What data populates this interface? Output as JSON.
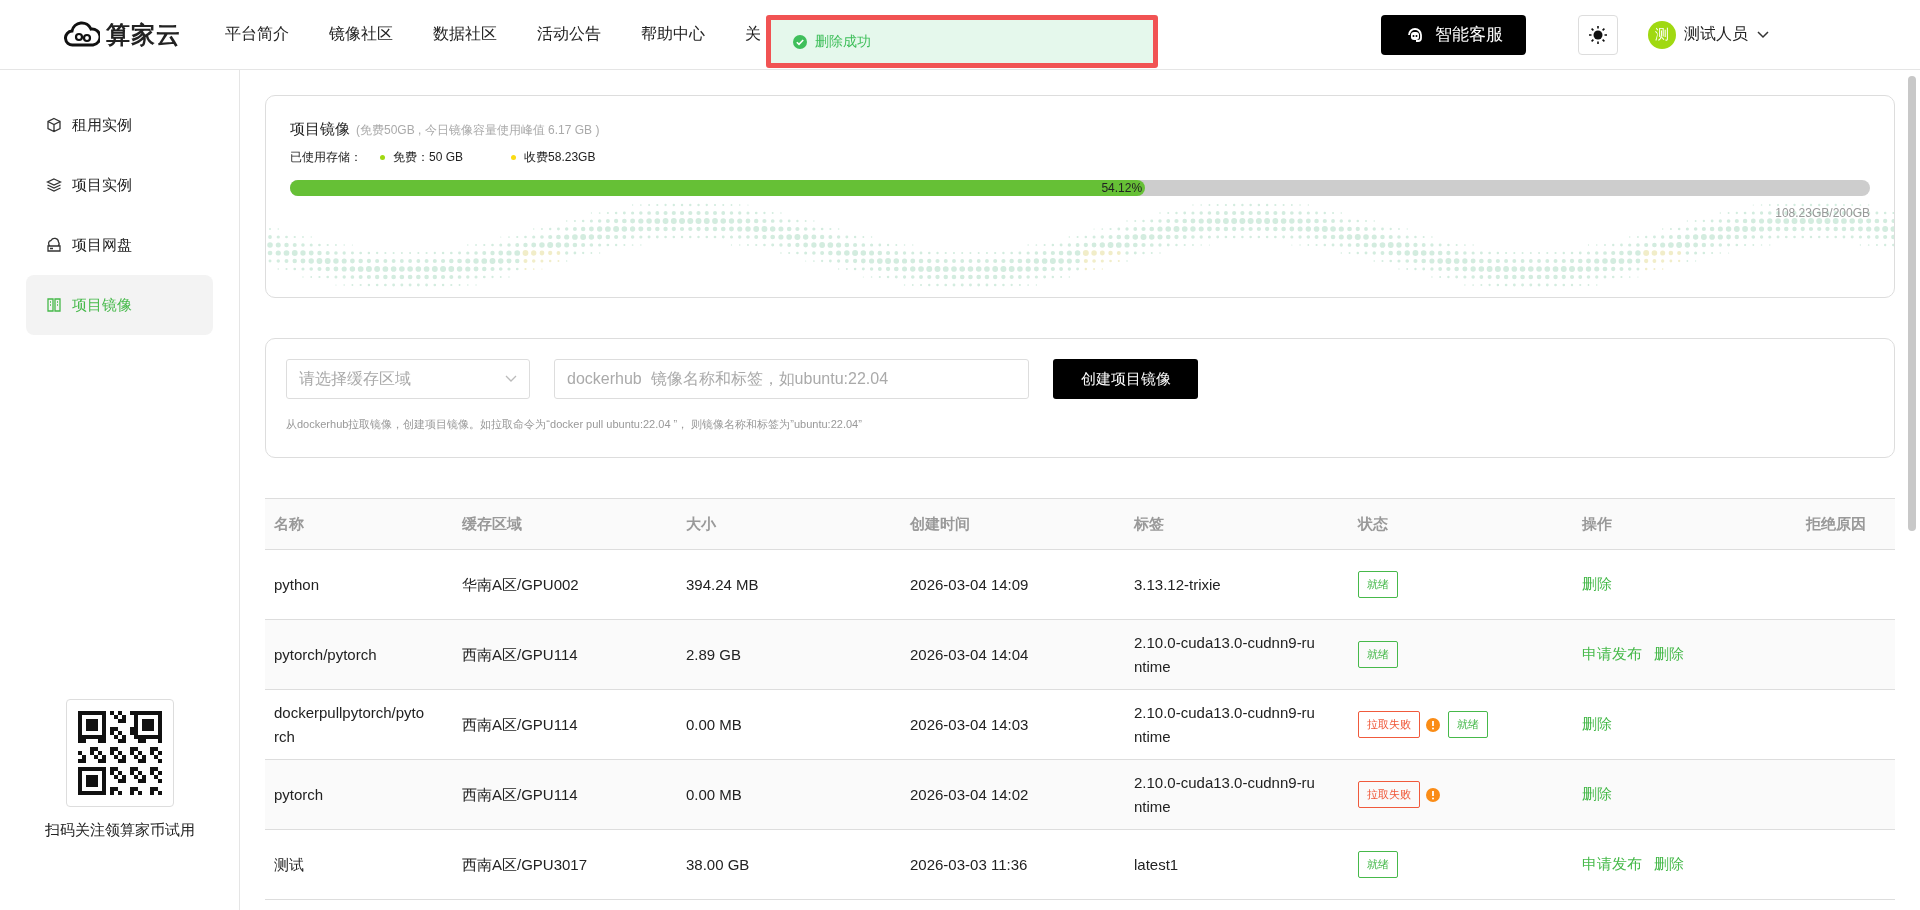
{
  "header": {
    "logo_text": "算家云",
    "nav": [
      {
        "label": "平台简介"
      },
      {
        "label": "镜像社区"
      },
      {
        "label": "数据社区"
      },
      {
        "label": "活动公告"
      },
      {
        "label": "帮助中心"
      },
      {
        "label": "关"
      }
    ],
    "support_button": "智能客服",
    "user": {
      "avatar": "测",
      "name": "测试人员"
    }
  },
  "toast": {
    "message": "删除成功"
  },
  "sidebar": {
    "items": [
      {
        "label": "租用实例",
        "selected": false
      },
      {
        "label": "项目实例",
        "selected": false
      },
      {
        "label": "项目网盘",
        "selected": false
      },
      {
        "label": "项目镜像",
        "selected": true
      }
    ],
    "qr_caption": "扫码关注领算家币试用"
  },
  "storage": {
    "title": "项目镜像",
    "note": "(免费50GB , 今日镜像容量使用峰值 6.17 GB )",
    "used_label": "已使用存储：",
    "legend": [
      {
        "label": "免费：50 GB",
        "color": "#a0d911"
      },
      {
        "label": "收费58.23GB",
        "color": "#fadb14"
      }
    ],
    "level": 0.5412,
    "percent": "54.12%",
    "total": "108.23GB/200GB"
  },
  "create": {
    "region_select": {
      "placeholder": "请选择缓存区域"
    },
    "image_field": {
      "placeholder": "dockerhub  镜像名称和标签，如ubuntu:22.04"
    },
    "button": "创建项目镜像",
    "hint": "从dockerhub拉取镜像，创建项目镜像。如拉取命令为“docker pull ubuntu:22.04 ”， 则镜像名称和标签为”ubuntu:22.04”"
  },
  "table": {
    "columns": [
      "名称",
      "缓存区域",
      "大小",
      "创建时间",
      "标签",
      "状态",
      "操作",
      "拒绝原因"
    ],
    "rows": [
      {
        "name": "python",
        "region": "华南A区/GPU002",
        "size": "394.24 MB",
        "created": "2026-03-04 14:09",
        "tag": "3.13.12-trixie",
        "statuses": [
          {
            "label": "就绪",
            "kind": "ready"
          }
        ],
        "actions": [
          "删除"
        ]
      },
      {
        "name": "pytorch/pytorch",
        "region": "西南A区/GPU114",
        "size": "2.89 GB",
        "created": "2026-03-04 14:04",
        "tag": "2.10.0-cuda13.0-cudnn9-runtime",
        "statuses": [
          {
            "label": "就绪",
            "kind": "ready"
          }
        ],
        "actions": [
          "申请发布",
          "删除"
        ]
      },
      {
        "name": "dockerpullpytorch/pytorch",
        "region": "西南A区/GPU114",
        "size": "0.00 MB",
        "created": "2026-03-04 14:03",
        "tag": "2.10.0-cuda13.0-cudnn9-runtime",
        "statuses": [
          {
            "label": "拉取失败",
            "kind": "failed",
            "warning": true
          },
          {
            "label": "就绪",
            "kind": "ready"
          }
        ],
        "actions": [
          "删除"
        ]
      },
      {
        "name": "pytorch",
        "region": "西南A区/GPU114",
        "size": "0.00 MB",
        "created": "2026-03-04 14:02",
        "tag": "2.10.0-cuda13.0-cudnn9-runtime",
        "statuses": [
          {
            "label": "拉取失败",
            "kind": "failed",
            "warning": true
          }
        ],
        "actions": [
          "删除"
        ]
      },
      {
        "name": "测试",
        "region": "西南A区/GPU3017",
        "size": "38.00 GB",
        "created": "2026-03-03 11:36",
        "tag": "latest1",
        "statuses": [
          {
            "label": "就绪",
            "kind": "ready"
          }
        ],
        "actions": [
          "申请发布",
          "删除"
        ]
      }
    ]
  }
}
